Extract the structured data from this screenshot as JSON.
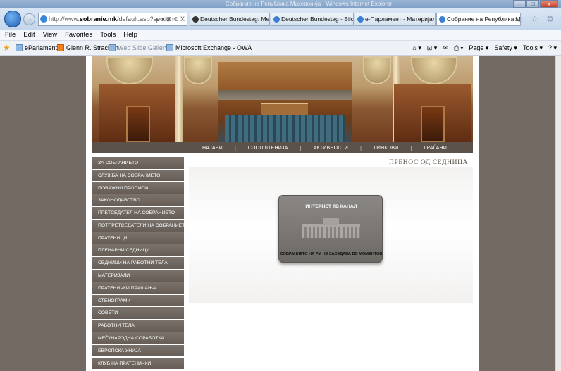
{
  "browser": {
    "window_title": "Собрание на Република Македонија - Windows Internet Explorer",
    "window_buttons": [
      "–",
      "□",
      "x"
    ],
    "address": {
      "prefix": "http://www.",
      "domain": "sobranie.mk",
      "path": "/default.asp?section=",
      "tools": "ρ ▾ ⊠ ⊙ X"
    },
    "tabs": [
      {
        "label": "Deutscher Bundestag: Mediath...",
        "active": false
      },
      {
        "label": "Deutscher Bundestag - Bilderdi...",
        "active": false
      },
      {
        "label": "е-Парламент - Материјали за...",
        "active": false
      },
      {
        "label": "Собрание на Република М...",
        "active": true,
        "close": "x"
      }
    ],
    "nav_icons": "⌂ ☆ ⚙",
    "menu": [
      "File",
      "Edit",
      "View",
      "Favorites",
      "Tools",
      "Help"
    ],
    "favorites": [
      {
        "label": "eParlament",
        "icon": "ie-page-icon",
        "muted": false
      },
      {
        "label": "Glenn R. Strachan",
        "icon": "blogger-icon",
        "muted": false
      },
      {
        "label": "Web Slice Gallery ▾",
        "icon": "web-slice-icon",
        "muted": true
      },
      {
        "label": "Microsoft Exchange - OWA",
        "icon": "ie-page-icon",
        "muted": false
      }
    ],
    "commands": [
      "⌂ ▾",
      "⊡ ▾",
      "✉",
      "⎙ ▾",
      "Page ▾",
      "Safety ▾",
      "Tools ▾",
      "? ▾"
    ]
  },
  "site": {
    "top_nav": [
      "НАЈАВИ",
      "СООПШТЕНИЈА",
      "АКТИВНОСТИ",
      "ЛИНКОВИ",
      "ГРАЃАНИ"
    ],
    "side_menu": [
      "ЗА СОБРАНИЕТО",
      "СЛУЖБА НА СОБРАНИЕТО",
      "ПОВАЖНИ ПРОПИСИ",
      "ЗАКОНОДАВСТВО",
      "ПРЕТСЕДАТЕЛ НА СОБРАНИЕТО",
      "ПОТПРЕТСЕДАТЕЛИ НА СОБРАНИЕТО",
      "ПРАТЕНИЦИ",
      "ПЛЕНАРНИ СЕДНИЦИ",
      "СЕДНИЦИ НА РАБОТНИ ТЕЛА",
      "МАТЕРИЈАЛИ",
      "ПРАТЕНИЧКИ ПРАШАЊА",
      "СТЕНОГРАМИ",
      "СОВЕТИ",
      "РАБОТНИ ТЕЛА",
      "МЕЃУНАРОДНА СОРАБОТКА",
      "ЕВРОПСКА УНИЈА",
      "КЛУБ НА ПРАТЕНИЧКИ"
    ],
    "section_title": "ПРЕНОС ОД СЕДНИЦА",
    "tv": {
      "title": "ИНТЕРНЕТ ТВ КАНАЛ",
      "status": "СОБРАНИЕТО НА РМ НЕ ЗАСЕДАВА ВО МОМЕНТОВ"
    }
  }
}
